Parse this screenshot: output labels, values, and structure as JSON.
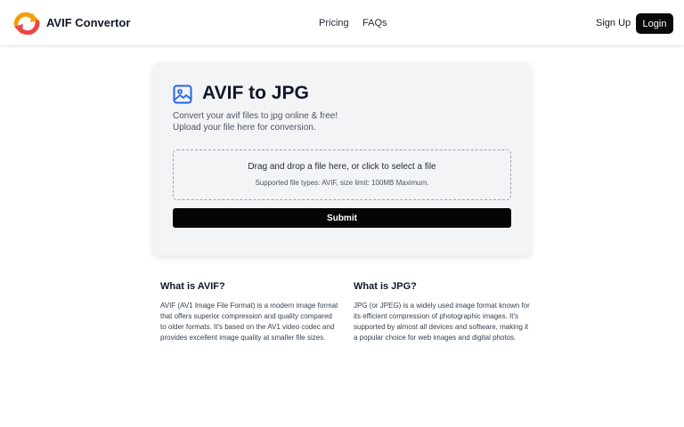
{
  "header": {
    "brand": "AVIF Convertor",
    "nav": {
      "pricing": "Pricing",
      "faqs": "FAQs"
    },
    "signup_label": "Sign Up",
    "login_label": "Login"
  },
  "converter": {
    "title": "AVIF to JPG",
    "desc_line1": "Convert your avif files to jpg online & free!",
    "desc_line2": "Upload your file here for conversion.",
    "dropzone_main": "Drag and drop a file here, or click to select a file",
    "dropzone_sub": "Supported file types: AVIF, size limit: 100MB Maximum.",
    "submit_label": "Submit"
  },
  "info": {
    "avif": {
      "heading": "What is AVIF?",
      "text": "AVIF (AV1 Image File Format) is a modern image format that offers superior compression and quality compared to older formats. It's based on the AV1 video codec and provides excellent image quality at smaller file sizes."
    },
    "jpg": {
      "heading": "What is JPG?",
      "text": "JPG (or JPEG) is a widely used image format known for its efficient compression of photographic images. It's supported by almost all devices and software, making it a popular choice for web images and digital photos."
    }
  },
  "colors": {
    "accent": "#050505",
    "logo_orange": "#f59e0b",
    "logo_red": "#ef4444",
    "icon_blue": "#2563eb"
  },
  "icons": {
    "logo": "refresh-arrows-icon",
    "title": "image-icon"
  }
}
